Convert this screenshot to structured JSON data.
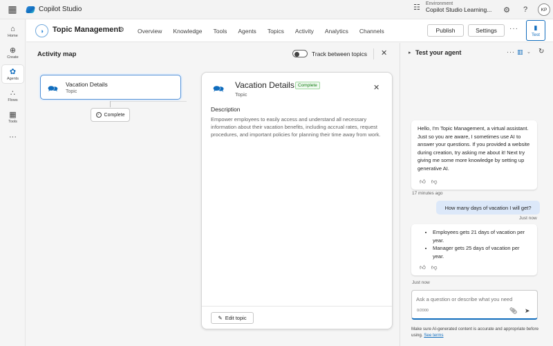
{
  "app": {
    "name": "Copilot Studio"
  },
  "environment": {
    "label": "Environment",
    "value": "Copilot Studio Learning..."
  },
  "user": {
    "initials": "KP"
  },
  "rail": [
    {
      "label": "Home",
      "icon": "home-icon"
    },
    {
      "label": "Create",
      "icon": "create-icon"
    },
    {
      "label": "Agents",
      "icon": "agents-icon",
      "active": true
    },
    {
      "label": "Flows",
      "icon": "flows-icon"
    },
    {
      "label": "Tools",
      "icon": "tools-icon"
    },
    {
      "label": "",
      "icon": "more-icon"
    }
  ],
  "topic": {
    "title": "Topic Management"
  },
  "nav": [
    "Overview",
    "Knowledge",
    "Tools",
    "Agents",
    "Topics",
    "Activity",
    "Analytics",
    "Channels"
  ],
  "actions": {
    "publish": "Publish",
    "settings": "Settings",
    "test": "Test"
  },
  "activity_map": {
    "title": "Activity map",
    "track_label": "Track between topics",
    "node": {
      "title": "Vacation Details",
      "subtitle": "Topic"
    },
    "status_pill": "Complete"
  },
  "detail_card": {
    "title": "Vacation Details",
    "status": "Complete",
    "subtitle": "Topic",
    "desc_heading": "Description",
    "description": "Empower employees to easily access and understand all necessary information about their vacation benefits, including accrual rates, request procedures, and important policies for planning their time away from work.",
    "edit_button": "Edit topic"
  },
  "test_panel": {
    "title": "Test your agent",
    "messages": {
      "greeting": "Hello, I'm Topic Management, a virtual assistant. Just so you are aware, I sometimes use AI to answer your questions. If you provided a website during creation, try asking me about it! Next try giving me some more knowledge by setting up generative AI.",
      "greeting_time": "17 minutes ago",
      "user_question": "How many days of vacation I will get?",
      "user_time": "Just now",
      "answer_items": [
        "Employees gets 21 days of vacation per year.",
        "Manager gets 25 days of vacation per year."
      ],
      "answer_time": "Just now"
    },
    "input": {
      "placeholder": "Ask a question or describe what you need",
      "counter": "0/2000"
    },
    "disclaimer": "Make sure AI-generated content is accurate and appropriate before using.",
    "terms_link": "See terms"
  },
  "colors": {
    "accent": "#0f6cbd",
    "complete": "#107c10",
    "user_bubble": "#dce8f9"
  }
}
